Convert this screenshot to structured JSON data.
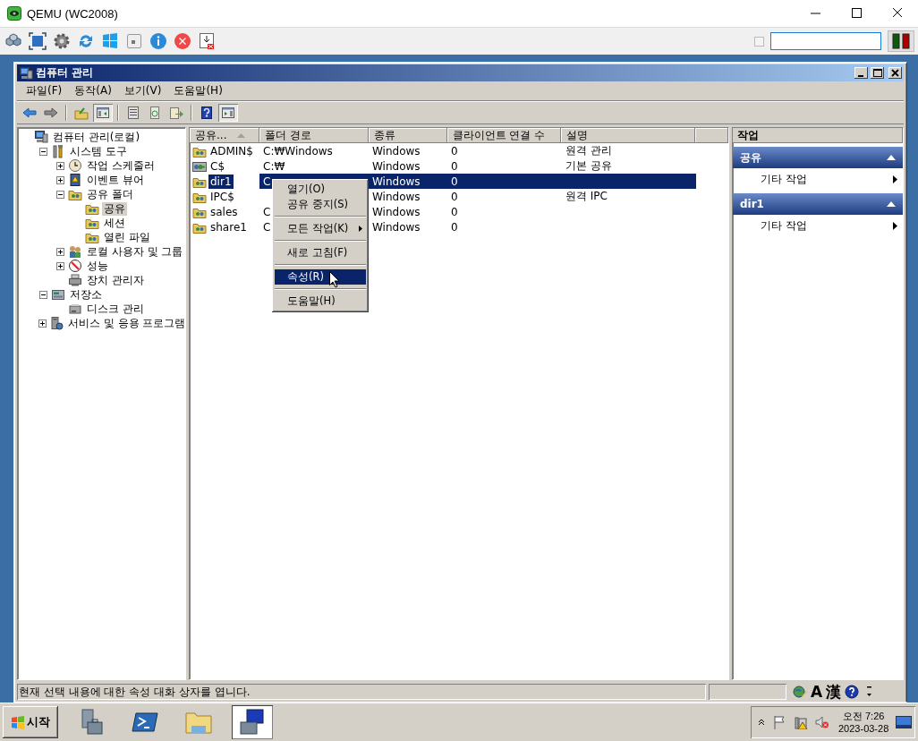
{
  "host_window": {
    "title": "QEMU (WC2008)"
  },
  "host_toolbar": {
    "checkbox": {
      "checked": false
    }
  },
  "mmc": {
    "title": "컴퓨터 관리",
    "menu": [
      "파일(F)",
      "동작(A)",
      "보기(V)",
      "도움말(H)"
    ],
    "toolbar": [
      {
        "kind": "back",
        "pressed": false
      },
      {
        "kind": "forward",
        "pressed": false
      },
      {
        "kind": "separator"
      },
      {
        "kind": "up",
        "pressed": false
      },
      {
        "kind": "tree",
        "pressed": true
      },
      {
        "kind": "separator"
      },
      {
        "kind": "properties",
        "pressed": false
      },
      {
        "kind": "refresh",
        "pressed": false
      },
      {
        "kind": "export",
        "pressed": false
      },
      {
        "kind": "separator"
      },
      {
        "kind": "help",
        "pressed": false
      },
      {
        "kind": "actionpane",
        "pressed": true
      }
    ],
    "tree": [
      {
        "label": "컴퓨터 관리(로컬)",
        "kind": "computer",
        "selected": false,
        "children": [
          {
            "label": "시스템 도구",
            "kind": "tools",
            "selected": false,
            "expanded": true,
            "children": [
              {
                "label": "작업 스케줄러",
                "kind": "clock",
                "selected": false,
                "expanded": false
              },
              {
                "label": "이벤트 뷰어",
                "kind": "event",
                "selected": false,
                "expanded": false
              },
              {
                "label": "공유 폴더",
                "kind": "share",
                "selected": false,
                "expanded": true,
                "children": [
                  {
                    "label": "공유",
                    "kind": "share",
                    "selected": true
                  },
                  {
                    "label": "세션",
                    "kind": "share",
                    "selected": false
                  },
                  {
                    "label": "열린 파일",
                    "kind": "share",
                    "selected": false
                  }
                ]
              },
              {
                "label": "로컬 사용자 및 그룹",
                "kind": "users",
                "selected": false,
                "expanded": false
              },
              {
                "label": "성능",
                "kind": "perf",
                "selected": false,
                "expanded": false
              },
              {
                "label": "장치 관리자",
                "kind": "device",
                "selected": false
              }
            ]
          },
          {
            "label": "저장소",
            "kind": "storage",
            "selected": false,
            "expanded": true,
            "children": [
              {
                "label": "디스크 관리",
                "kind": "disk",
                "selected": false
              }
            ]
          },
          {
            "label": "서비스 및 응용 프로그램",
            "kind": "services",
            "selected": false,
            "expanded": false
          }
        ]
      }
    ],
    "list": {
      "columns": [
        {
          "label": "공유...",
          "sorted": true
        },
        {
          "label": "폴더 경로",
          "sorted": false
        },
        {
          "label": "종류",
          "sorted": false
        },
        {
          "label": "클라이언트 연결 수",
          "sorted": false
        },
        {
          "label": "설명",
          "sorted": false
        }
      ],
      "rows": [
        {
          "name": "ADMIN$",
          "kind": "share",
          "path": "C:₩Windows",
          "type": "Windows",
          "clients": "0",
          "description": "원격 관리",
          "selected": false
        },
        {
          "name": "C$",
          "kind": "drive",
          "path": "C:₩",
          "type": "Windows",
          "clients": "0",
          "description": "기본 공유",
          "selected": false
        },
        {
          "name": "dir1",
          "kind": "share",
          "path": "C",
          "type": "Windows",
          "clients": "0",
          "selected": true
        },
        {
          "name": "IPC$",
          "kind": "share",
          "type": "Windows",
          "clients": "0",
          "description": "원격 IPC",
          "selected": false
        },
        {
          "name": "sales",
          "kind": "share",
          "path": "C",
          "type": "Windows",
          "clients": "0",
          "selected": false
        },
        {
          "name": "share1",
          "kind": "share",
          "path": "C",
          "type": "Windows",
          "clients": "0",
          "selected": false
        }
      ]
    },
    "context_menu": {
      "groups": [
        [
          {
            "label": "열기(O)",
            "selected": false,
            "submenu": false
          },
          {
            "label": "공유 중지(S)",
            "selected": false,
            "submenu": false
          }
        ],
        [
          {
            "label": "모든 작업(K)",
            "selected": false,
            "submenu": true
          }
        ],
        [
          {
            "label": "새로 고침(F)",
            "selected": false,
            "submenu": false
          }
        ],
        [
          {
            "label": "속성(R)",
            "selected": true,
            "submenu": false
          }
        ],
        [
          {
            "label": "도움말(H)",
            "selected": false,
            "submenu": false
          }
        ]
      ]
    },
    "actions": {
      "title": "작업",
      "sections": [
        {
          "title": "공유",
          "expanded": true,
          "items": [
            {
              "label": "기타 작업",
              "submenu": true
            }
          ]
        },
        {
          "title": "dir1",
          "expanded": true,
          "items": [
            {
              "label": "기타 작업",
              "submenu": true
            }
          ]
        }
      ]
    },
    "status_bar": {
      "text": "현재 선택 내용에 대한 속성 대화 상자를 엽니다.",
      "language_bar": [
        "A",
        "漢"
      ]
    }
  },
  "taskbar": {
    "start": "시작",
    "apps": [
      {
        "kind": "server",
        "active": false
      },
      {
        "kind": "shell",
        "active": false
      },
      {
        "kind": "explorer",
        "active": false
      },
      {
        "kind": "mgmt",
        "active": true
      }
    ],
    "clock": {
      "time": "오전 7:26",
      "date": "2023-03-28"
    }
  }
}
